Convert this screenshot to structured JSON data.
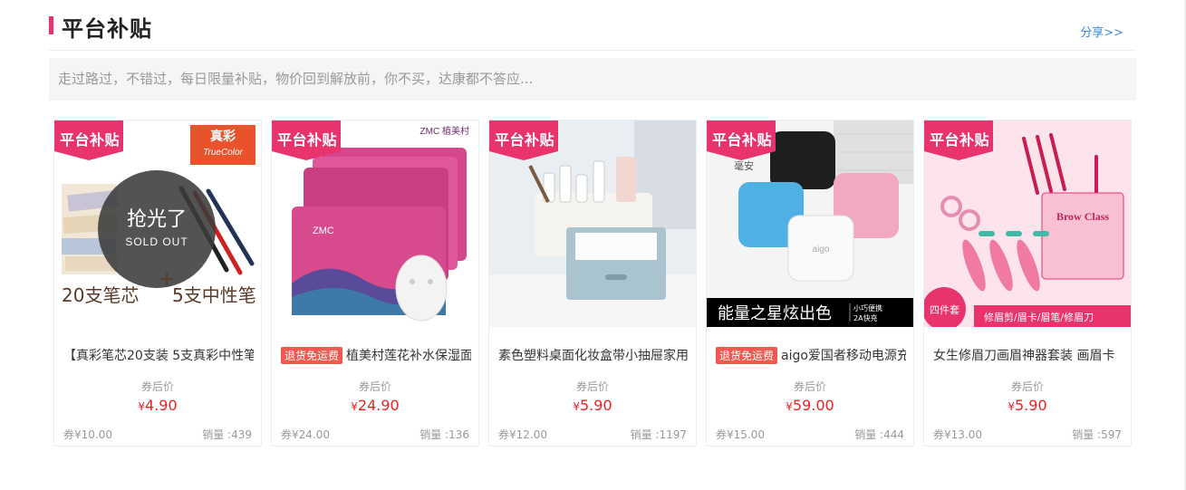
{
  "section": {
    "title": "平台补贴",
    "share_label": "分享>>",
    "notice": "走过路过，不错过，每日限量补贴，物价回到解放前，你不买，达康都不答应..."
  },
  "ribbon_label": "平台补贴",
  "currency": "¥",
  "after_coupon_label": "券后价",
  "products": [
    {
      "tag": "",
      "name": "【真彩笔芯20支装 5支真彩中性笔",
      "price": "4.90",
      "coupon_price": "券¥10.00",
      "sales": "销量 :439",
      "image_text": {
        "brand_cn": "真彩",
        "brand_en": "TrueColor",
        "sold_out_cn": "抢光了",
        "sold_out_en": "SOLD OUT",
        "left_caption": "20支笔芯",
        "plus": "+",
        "right_caption": "5支中性笔"
      }
    },
    {
      "tag": "退货免运费",
      "name": "植美村莲花补水保湿面膜",
      "price": "24.90",
      "coupon_price": "券¥24.00",
      "sales": "销量 :136",
      "image_text": {
        "brand": "ZMC 植美村",
        "pack": "ZMC"
      }
    },
    {
      "tag": "",
      "name": "素色塑料桌面化妆盒带小抽屉家用",
      "price": "5.90",
      "coupon_price": "券¥12.00",
      "sales": "销量 :1197",
      "image_text": {}
    },
    {
      "tag": "退货免运费",
      "name": "aigo爱国者移动电源充电宝",
      "price": "59.00",
      "coupon_price": "券¥15.00",
      "sales": "销量 :444",
      "image_text": {
        "corner": "毫安",
        "case_logo": "aigo",
        "banner": "能量之星炫出色",
        "banner_small_1": "小巧便携",
        "banner_small_2": "2A快充"
      }
    },
    {
      "tag": "",
      "name": "女生修眉刀画眉神器套装 画眉卡",
      "price": "5.90",
      "coupon_price": "券¥13.00",
      "sales": "销量 :597",
      "image_text": {
        "box_title": "Brow Class",
        "set_label": "四件套",
        "footer": "修眉剪/眉卡/眉笔/修眉刀"
      }
    }
  ],
  "colors": {
    "accent": "#e8336d",
    "ribbon": "#e8336d",
    "price": "#ee2222",
    "tag": "#ee5a4f",
    "share": "#3b8ad9"
  }
}
